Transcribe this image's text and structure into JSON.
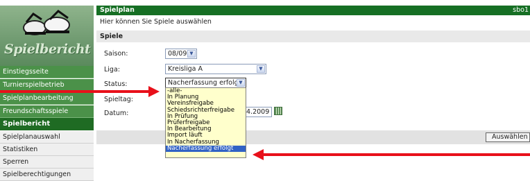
{
  "sidebar": {
    "logo_text": "Spielbericht",
    "items": [
      {
        "label": "Einstiegsseite"
      },
      {
        "label": "Turnierspielbetrieb"
      },
      {
        "label": "Spielplanbearbeitung"
      },
      {
        "label": "Freundschaftsspiele"
      },
      {
        "label": "Spielbericht"
      },
      {
        "label": "Spielplanauswahl"
      },
      {
        "label": "Statistiken"
      },
      {
        "label": "Sperren"
      },
      {
        "label": "Spielberechtigungen"
      }
    ]
  },
  "header": {
    "title": "Spielplan",
    "user": "sbo1"
  },
  "intro": "Hier können Sie Spiele auswählen",
  "section_title": "Spiele",
  "form": {
    "saison": {
      "label": "Saison:",
      "value": "08/09"
    },
    "liga": {
      "label": "Liga:",
      "value": "Kreisliga A"
    },
    "status": {
      "label": "Status:",
      "value": "Nacherfassung erfolgt"
    },
    "spieltag": {
      "label": "Spieltag:"
    },
    "datum": {
      "label": "Datum:",
      "value": "4.2009"
    }
  },
  "dropdown_options": [
    "-alle-",
    "In Planung",
    "Vereinsfreigabe",
    "Schiedsrichterfreigabe",
    "In Prüfung",
    "Prüferfreigabe",
    "In Bearbeitung",
    "Import läuft",
    "In Nacherfassung",
    "Nacherfassung erfolgt"
  ],
  "selected_option_index": 9,
  "buttons": {
    "auswahlen": "Auswählen"
  },
  "colors": {
    "header_green": "#166f24",
    "nav_green": "#4b9149",
    "highlight": "#3162c5",
    "arrow": "#e8101a"
  }
}
